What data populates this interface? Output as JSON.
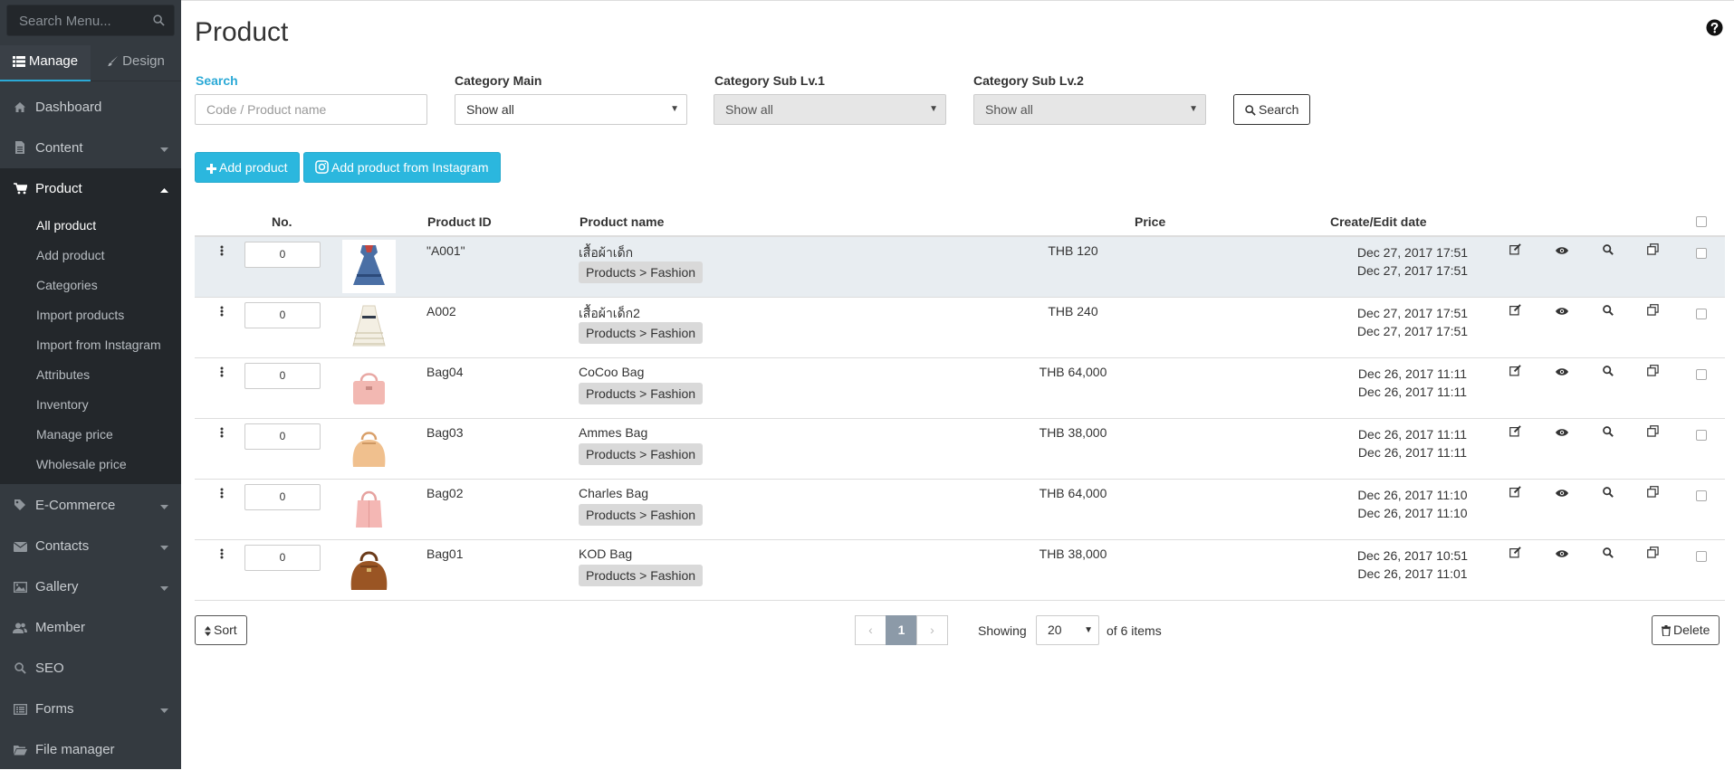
{
  "sidebar": {
    "search_placeholder": "Search Menu...",
    "tabs": [
      {
        "label": "Manage",
        "icon": "list-icon",
        "active": true
      },
      {
        "label": "Design",
        "icon": "brush-icon",
        "active": false
      }
    ],
    "items": [
      {
        "label": "Dashboard",
        "icon": "dashboard-icon"
      },
      {
        "label": "Content",
        "icon": "file-icon",
        "caret": "down"
      },
      {
        "label": "Product",
        "icon": "cart-icon",
        "caret": "up",
        "active": true
      },
      {
        "label": "E-Commerce",
        "icon": "tag-icon",
        "caret": "down"
      },
      {
        "label": "Contacts",
        "icon": "envelope-icon",
        "caret": "down"
      },
      {
        "label": "Gallery",
        "icon": "image-icon",
        "caret": "down"
      },
      {
        "label": "Member",
        "icon": "users-icon"
      },
      {
        "label": "SEO",
        "icon": "search-icon"
      },
      {
        "label": "Forms",
        "icon": "list-alt-icon",
        "caret": "down"
      },
      {
        "label": "File manager",
        "icon": "folder-icon"
      }
    ],
    "product_submenu": [
      {
        "label": "All product",
        "active": true
      },
      {
        "label": "Add product"
      },
      {
        "label": "Categories"
      },
      {
        "label": "Import products"
      },
      {
        "label": "Import from Instagram"
      },
      {
        "label": "Attributes"
      },
      {
        "label": "Inventory"
      },
      {
        "label": "Manage price"
      },
      {
        "label": "Wholesale price"
      }
    ]
  },
  "page": {
    "title": "Product",
    "help_icon": "question-circle-icon"
  },
  "filters": {
    "search_label": "Search",
    "search_placeholder": "Code / Product name",
    "category_main_label": "Category Main",
    "category_main_value": "Show all",
    "category_sub1_label": "Category Sub Lv.1",
    "category_sub1_value": "Show all",
    "category_sub2_label": "Category Sub Lv.2",
    "category_sub2_value": "Show all",
    "search_button": "Search"
  },
  "actions": {
    "add_product": "Add product",
    "add_from_instagram": "Add product from Instagram"
  },
  "table": {
    "columns": {
      "no": "No.",
      "product_id": "Product ID",
      "product_name": "Product name",
      "price": "Price",
      "date": "Create/Edit date"
    },
    "rows": [
      {
        "order": "0",
        "id": "\"A001\"",
        "name": "เสื้อผ้าเด็ก",
        "category": "Products > Fashion",
        "price": "THB 120",
        "created": "Dec 27, 2017 17:51",
        "edited": "Dec 27, 2017 17:51",
        "thumb": "dress",
        "highlight": true
      },
      {
        "order": "0",
        "id": "A002",
        "name": "เสื้อผ้าเด็ก2",
        "category": "Products > Fashion",
        "price": "THB 240",
        "created": "Dec 27, 2017 17:51",
        "edited": "Dec 27, 2017 17:51",
        "thumb": "white-dress"
      },
      {
        "order": "0",
        "id": "Bag04",
        "name": "CoCoo Bag",
        "category": "Products > Fashion",
        "price": "THB 64,000",
        "created": "Dec 26, 2017 11:11",
        "edited": "Dec 26, 2017 11:11",
        "thumb": "pink-bag"
      },
      {
        "order": "0",
        "id": "Bag03",
        "name": "Ammes Bag",
        "category": "Products > Fashion",
        "price": "THB 38,000",
        "created": "Dec 26, 2017 11:11",
        "edited": "Dec 26, 2017 11:11",
        "thumb": "beige-bag"
      },
      {
        "order": "0",
        "id": "Bag02",
        "name": "Charles Bag",
        "category": "Products > Fashion",
        "price": "THB 64,000",
        "created": "Dec 26, 2017 11:10",
        "edited": "Dec 26, 2017 11:10",
        "thumb": "pink-tote"
      },
      {
        "order": "0",
        "id": "Bag01",
        "name": "KOD Bag",
        "category": "Products > Fashion",
        "price": "THB 38,000",
        "created": "Dec 26, 2017 10:51",
        "edited": "Dec 26, 2017 11:01",
        "thumb": "brown-bag"
      }
    ],
    "row_actions": [
      "edit-icon",
      "eye-icon",
      "search-icon",
      "copy-icon"
    ]
  },
  "footer": {
    "sort_button": "Sort",
    "pager_prev": "‹",
    "pager_current": "1",
    "pager_next": "›",
    "showing_label": "Showing",
    "per_page": "20",
    "items_text": "of 6 items",
    "delete_button": "Delete"
  },
  "colors": {
    "sidebar_bg": "#343a40",
    "accent": "#2bb7de",
    "row_highlight": "#e8edf1"
  }
}
